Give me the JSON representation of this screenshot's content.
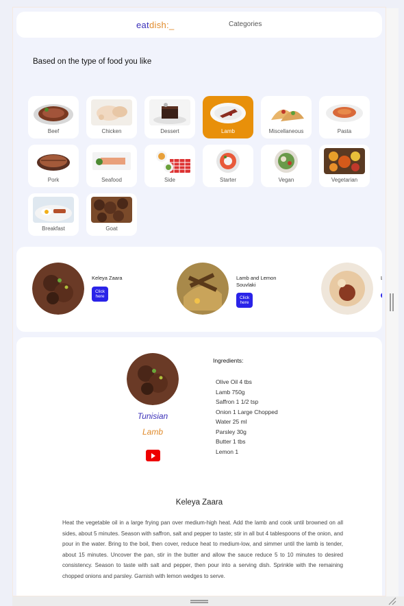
{
  "nav": {
    "logo_eat": "eat",
    "logo_dish": "dish",
    "logo_suffix": ":_",
    "categories_label": "Categories"
  },
  "heading": "Based on the type of food you like",
  "categories": [
    {
      "label": "Beef",
      "active": false
    },
    {
      "label": "Chicken",
      "active": false
    },
    {
      "label": "Dessert",
      "active": false
    },
    {
      "label": "Lamb",
      "active": true
    },
    {
      "label": "Miscellaneous",
      "active": false
    },
    {
      "label": "Pasta",
      "active": false
    },
    {
      "label": "Pork",
      "active": false
    },
    {
      "label": "Seafood",
      "active": false
    },
    {
      "label": "Side",
      "active": false
    },
    {
      "label": "Starter",
      "active": false
    },
    {
      "label": "Vegan",
      "active": false
    },
    {
      "label": "Vegetarian",
      "active": false
    },
    {
      "label": "Breakfast",
      "active": false
    },
    {
      "label": "Goat",
      "active": false
    }
  ],
  "recipes": [
    {
      "title": "Keleya Zaara",
      "button": "Click here"
    },
    {
      "title": "Lamb and Lemon Souvlaki",
      "button": "Click here"
    },
    {
      "title": "L P",
      "button": ""
    }
  ],
  "detail": {
    "area": "Tunisian",
    "category": "Lamb",
    "ingredients_heading": "Ingredients:",
    "ingredients": [
      "Olive Oil 4 tbs",
      "Lamb 750g",
      "Saffron 1 1/2 tsp",
      "Onion 1 Large Chopped",
      "Water 25 ml",
      "Parsley 30g",
      "Butter 1 tbs",
      "Lemon 1"
    ],
    "title": "Keleya Zaara",
    "instructions": "Heat the vegetable oil in a large frying pan over medium-high heat. Add the lamb and cook until browned on all sides, about 5 minutes. Season with saffron, salt and pepper to taste; stir in all but 4 tablespoons of the onion, and pour in the water. Bring to the boil, then cover, reduce heat to medium-low, and simmer until the lamb is tender, about 15 minutes. Uncover the pan, stir in the butter and allow the sauce reduce 5 to 10 minutes to desired consistency. Season to taste with salt and pepper, then pour into a serving dish. Sprinkle with the remaining chopped onions and parsley. Garnish with lemon wedges to serve."
  },
  "colors": {
    "accent": "#e8900a",
    "primary": "#2a23e8",
    "logo_blue": "#3a2fb8",
    "logo_orange": "#e08a2a",
    "youtube": "#ee0000"
  }
}
